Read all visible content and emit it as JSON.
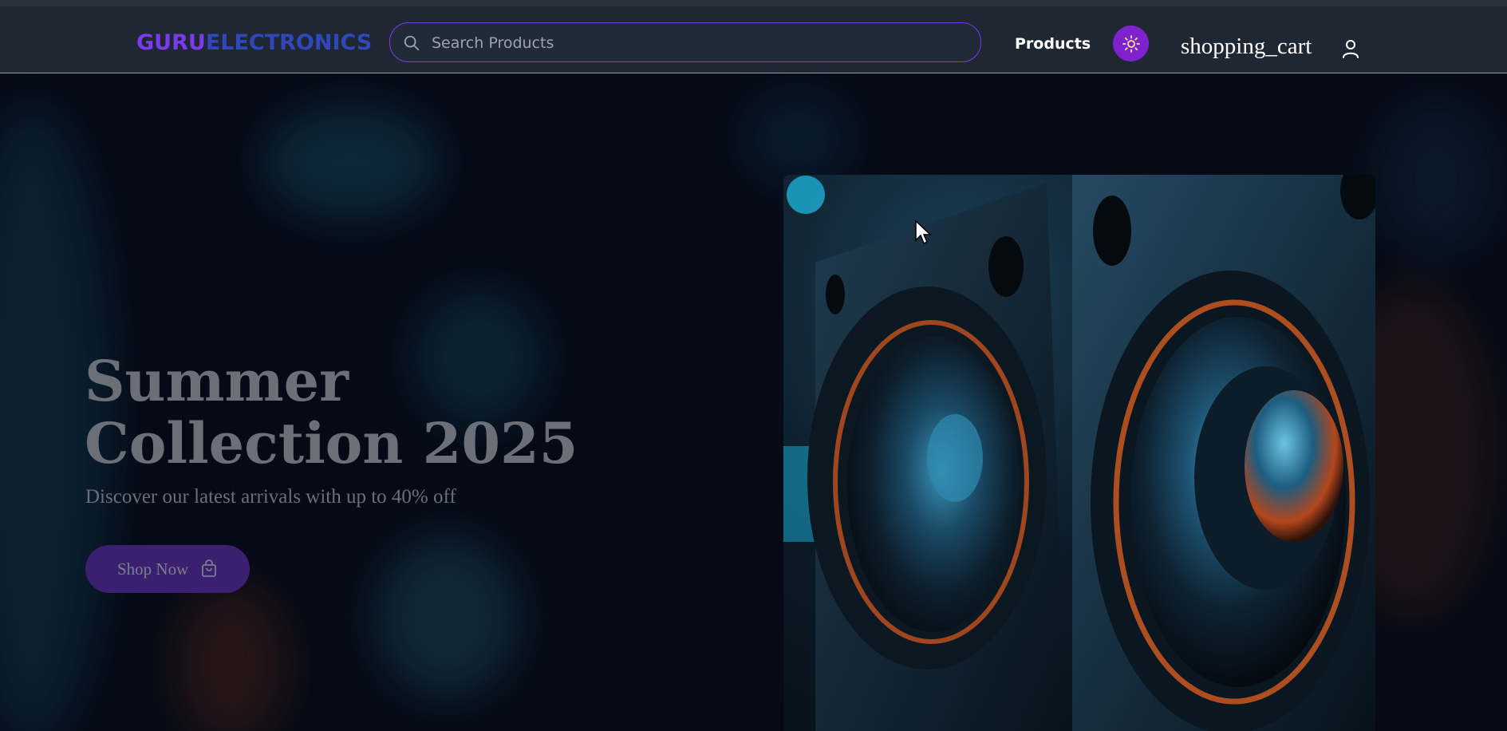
{
  "header": {
    "logo_part1": "GURU",
    "logo_part2": "ELECTRONICS",
    "search_placeholder": "Search Products",
    "nav_products": "Products",
    "theme_toggle_icon": "sun-icon",
    "cart_text": "shopping_cart",
    "user_icon": "user-icon"
  },
  "hero": {
    "title": "Summer Collection 2025",
    "subtitle": "Discover our latest arrivals with up to 40% off",
    "cta_label": "Shop Now",
    "cta_icon": "shopping-bag-icon",
    "image": "speakers-closeup-image"
  },
  "colors": {
    "accent": "#7c3aed",
    "logo_secondary": "#2f47b8",
    "navbar_bg": "#1f2733",
    "theme_button": "#7e22ce",
    "hero_text": "#6b7078",
    "cta_bg": "#3b1f70"
  }
}
